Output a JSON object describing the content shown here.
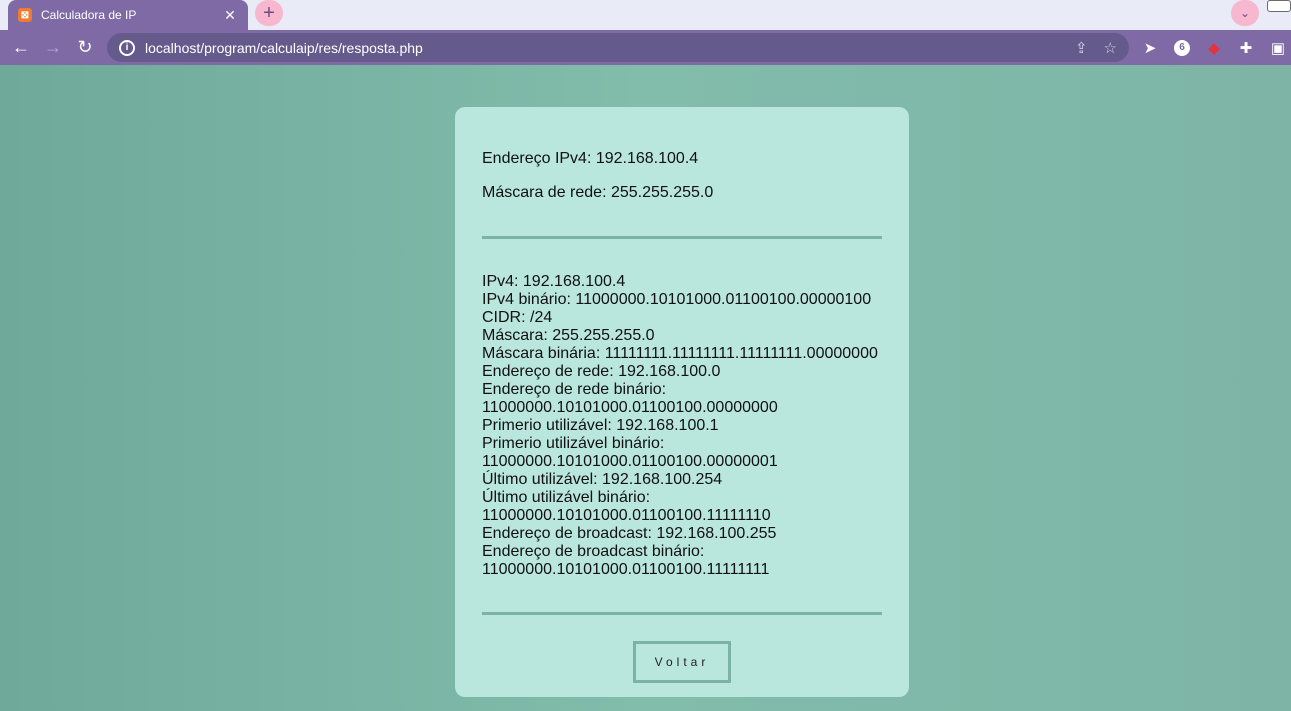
{
  "browser": {
    "tab_title": "Calculadora de IP",
    "tab_favicon": "xampp-icon",
    "tab_close": "✕",
    "new_tab": "+",
    "tab_search": "⌄",
    "url": "localhost/program/calculaip/res/resposta.php",
    "info_glyph": "i"
  },
  "page": {
    "endereco_ipv4": "Endereço IPv4: 192.168.100.4",
    "mascara_rede": "Máscara de rede: 255.255.255.0",
    "details": [
      "IPv4: 192.168.100.4",
      "IPv4 binário: 11000000.10101000.01100100.00000100",
      "CIDR: /24",
      "Máscara: 255.255.255.0",
      "Máscara binária: 11111111.11111111.11111111.00000000",
      "Endereço de rede: 192.168.100.0",
      "Endereço de rede binário:",
      "11000000.10101000.01100100.00000000",
      "Primerio utilizável: 192.168.100.1",
      "Primerio utilizável binário:",
      "11000000.10101000.01100100.00000001",
      "Último utilizável: 192.168.100.254",
      "Último utilizável binário:",
      "11000000.10101000.01100100.11111110",
      "Endereço de broadcast: 192.168.100.255",
      "Endereço de broadcast binário:",
      "11000000.10101000.01100100.11111111"
    ],
    "back_button": "Voltar"
  },
  "colors": {
    "chrome_purple": "#7f6aa6",
    "page_bg": "#7db8a8",
    "card_bg": "#b9e6dd",
    "divider": "#7db3a6"
  }
}
